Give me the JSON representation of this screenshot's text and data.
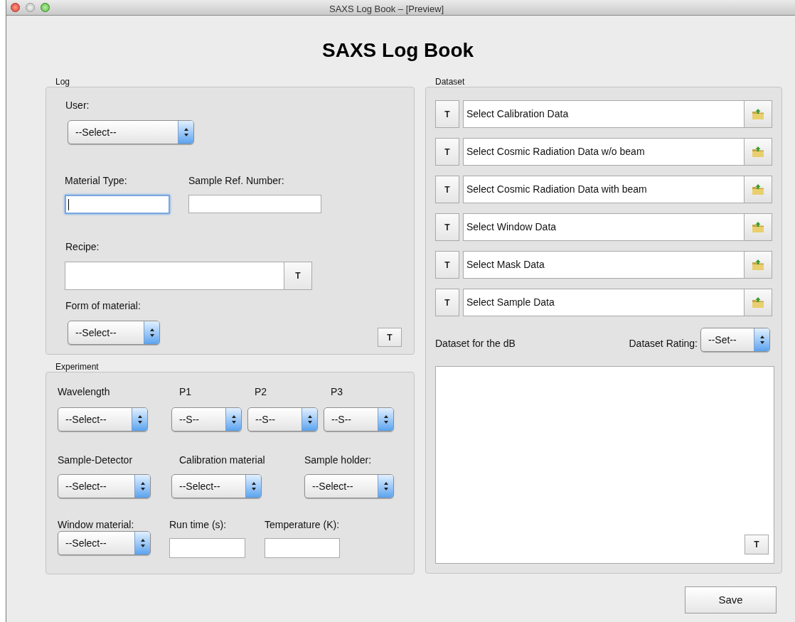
{
  "window": {
    "title": "SAXS Log Book – [Preview]"
  },
  "heading": "SAXS Log Book",
  "log": {
    "label": "Log",
    "user": {
      "label": "User:",
      "value": "--Select--"
    },
    "material_type": {
      "label": "Material Type:",
      "focused": true
    },
    "sample_ref_number": {
      "label": "Sample Ref. Number:",
      "focused": false
    },
    "recipe": {
      "label": "Recipe:",
      "button": "T"
    },
    "form_of_material": {
      "label": "Form of material:",
      "value": "--Select--"
    },
    "button": "T"
  },
  "experiment": {
    "label": "Experiment",
    "rows": [
      [
        {
          "label": "Wavelength",
          "kind": "select",
          "value": "--Select--"
        },
        {
          "label": "P1",
          "kind": "select",
          "value": "--S--"
        },
        {
          "label": "P2",
          "kind": "select",
          "value": "--S--"
        },
        {
          "label": "P3",
          "kind": "select",
          "value": "--S--"
        }
      ],
      [
        {
          "label": "Sample-Detector",
          "kind": "select",
          "value": "--Select--"
        },
        {
          "label": "Calibration material",
          "kind": "select",
          "value": "--Select--"
        },
        {
          "label": "Sample holder:",
          "kind": "select",
          "value": "--Select--"
        }
      ],
      [
        {
          "label": "Window material:",
          "kind": "select",
          "value": "--Select--"
        },
        {
          "label": "Run time (s):",
          "kind": "field"
        },
        {
          "label": "Temperature (K):",
          "kind": "field"
        }
      ]
    ]
  },
  "dataset": {
    "label": "Dataset",
    "rows": [
      {
        "button": "T",
        "value": "Select Calibration Data"
      },
      {
        "button": "T",
        "value": "Select Cosmic Radiation Data w/o beam"
      },
      {
        "button": "T",
        "value": "Select Cosmic Radiation Data with beam"
      },
      {
        "button": "T",
        "value": "Select Window Data"
      },
      {
        "button": "T",
        "value": "Select Mask Data"
      },
      {
        "button": "T",
        "value": "Select Sample Data"
      }
    ],
    "db_label": "Dataset for the dB",
    "rating": {
      "label": "Dataset Rating:",
      "value": "--Set--"
    },
    "notes_button": "T"
  },
  "save_button": "Save"
}
